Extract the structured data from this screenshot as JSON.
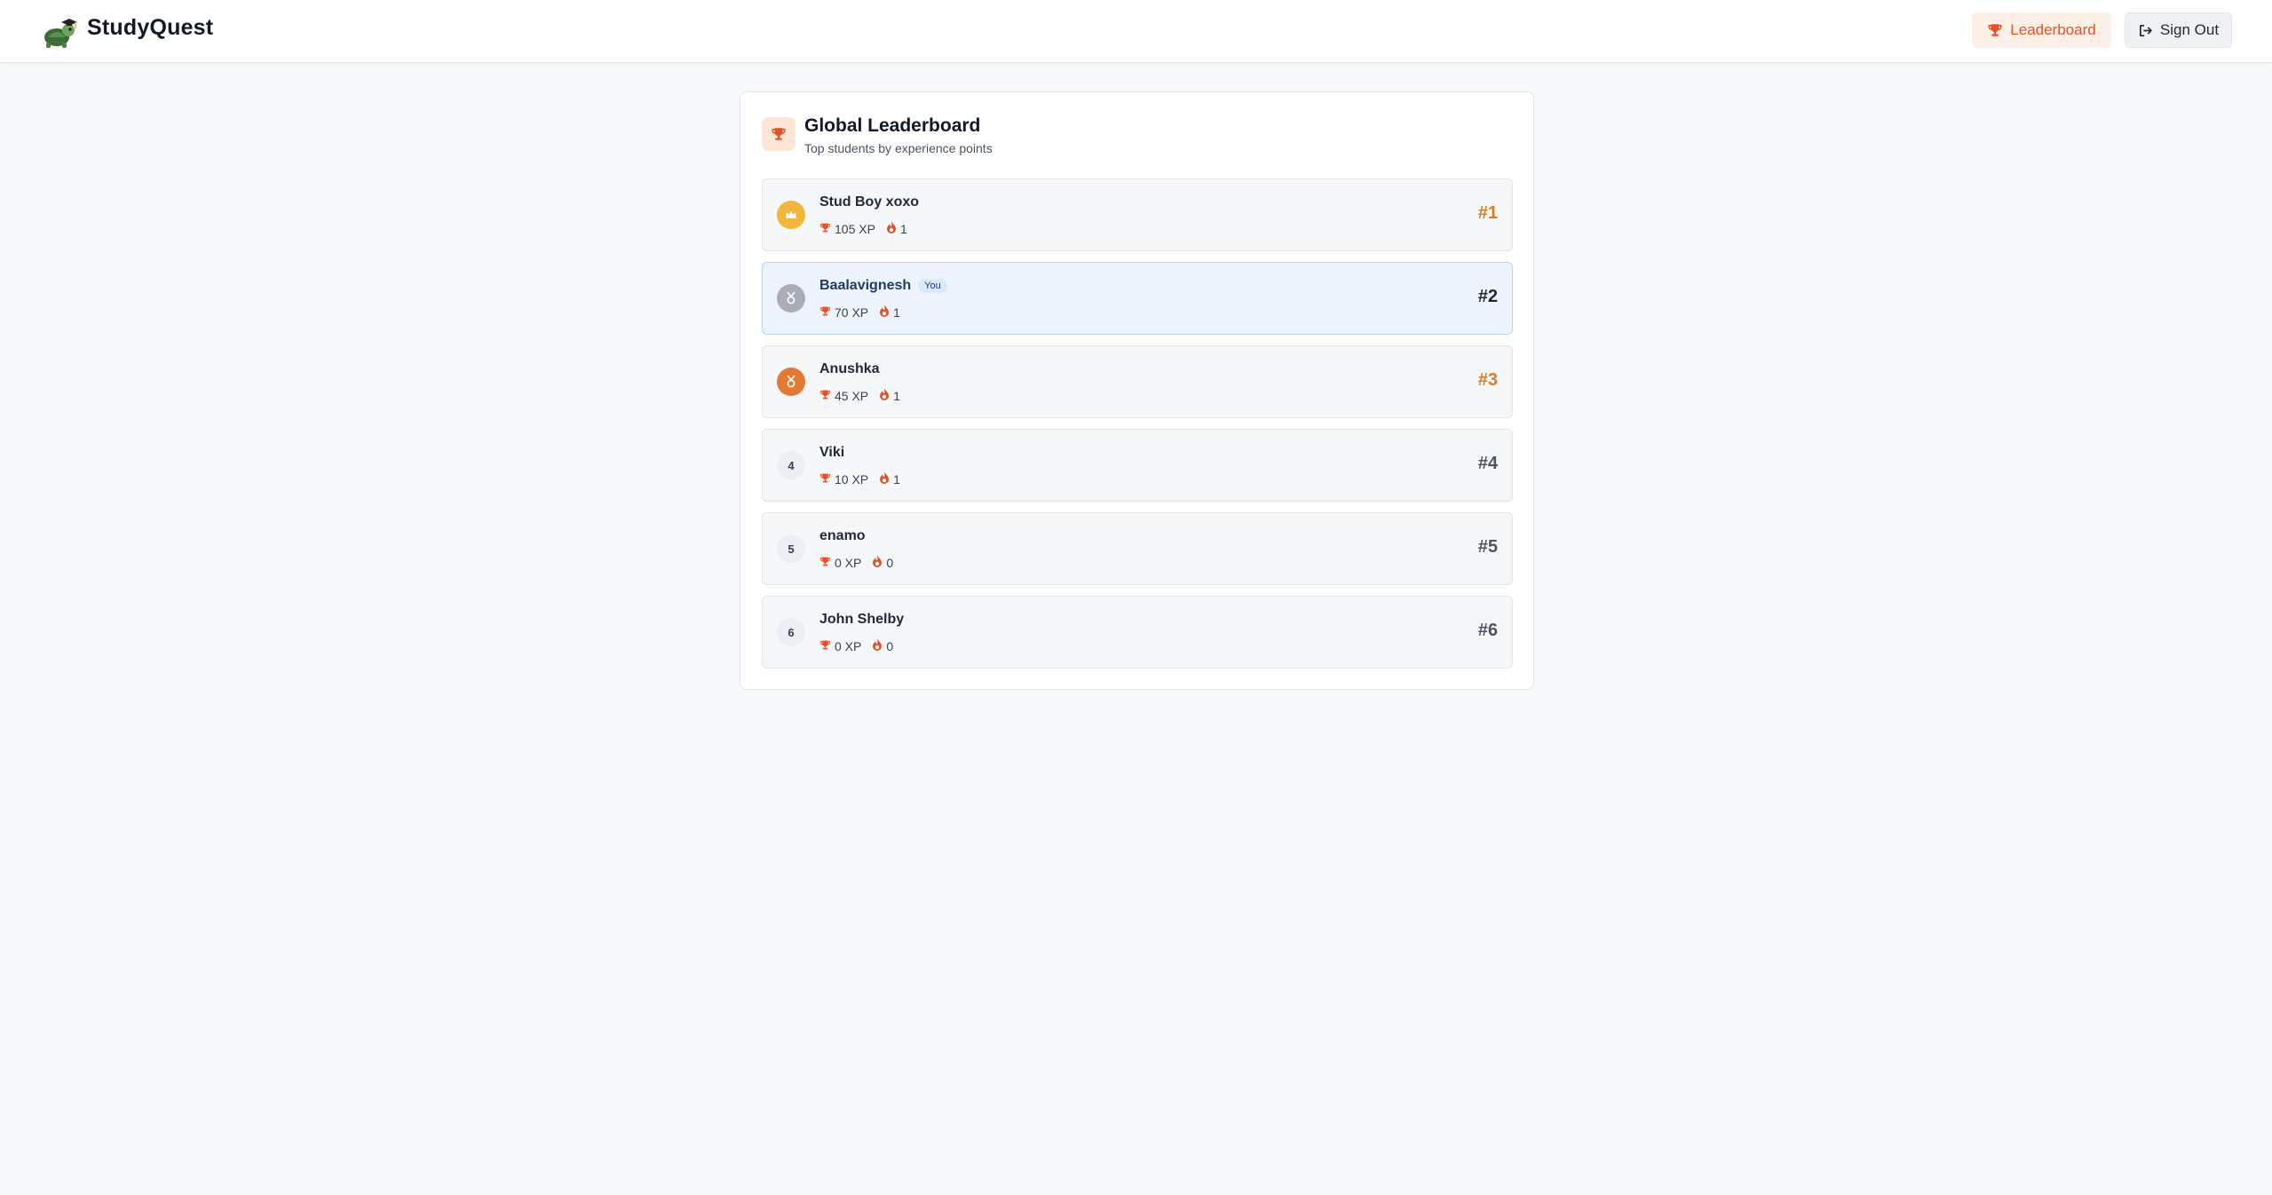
{
  "header": {
    "app_name": "StudyQuest",
    "leaderboard_label": "Leaderboard",
    "signout_label": "Sign Out"
  },
  "leaderboard": {
    "title": "Global Leaderboard",
    "subtitle": "Top students by experience points",
    "you_label": "You",
    "entries": [
      {
        "badge": "crown-icon",
        "name": "Stud Boy xoxo",
        "xp": "105 XP",
        "streak": "1",
        "rank": "#1"
      },
      {
        "badge": "medal-icon",
        "name": "Baalavignesh",
        "xp": "70 XP",
        "streak": "1",
        "rank": "#2",
        "is_you": true
      },
      {
        "badge": "medal-icon",
        "name": "Anushka",
        "xp": "45 XP",
        "streak": "1",
        "rank": "#3"
      },
      {
        "badge": "4",
        "name": "Viki",
        "xp": "10 XP",
        "streak": "1",
        "rank": "#4"
      },
      {
        "badge": "5",
        "name": "enamo",
        "xp": "0 XP",
        "streak": "0",
        "rank": "#5"
      },
      {
        "badge": "6",
        "name": "John Shelby",
        "xp": "0 XP",
        "streak": "0",
        "rank": "#6"
      }
    ]
  },
  "colors": {
    "accent": "#e2522a",
    "gold": "#f2b63c",
    "silver": "#a8adb6",
    "bronze": "#e27a33",
    "highlight_row": "#edf4fd"
  }
}
